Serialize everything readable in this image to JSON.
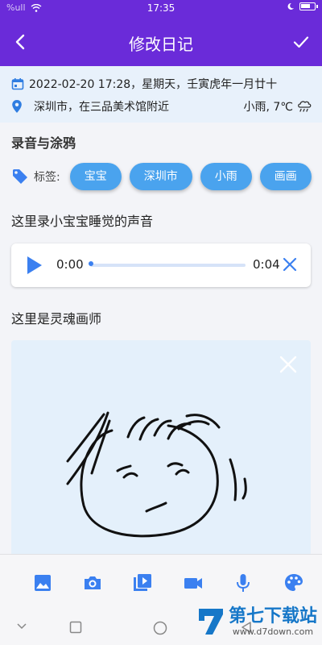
{
  "status_bar": {
    "signal_text": "%ull",
    "time": "17:35"
  },
  "app_bar": {
    "title": "修改日记",
    "back_icon": "arrow-back-icon",
    "confirm_icon": "check-icon"
  },
  "meta": {
    "datetime": "2022-02-20 17:28，星期天，壬寅虎年一月廿十",
    "location": "深圳市，在三品美术馆附近",
    "weather": "小雨, 7℃"
  },
  "section_title": "录音与涂鸦",
  "tags": {
    "label": "标签:",
    "items": [
      "宝宝",
      "深圳市",
      "小雨",
      "画画"
    ]
  },
  "audio_caption": "这里录小宝宝睡觉的声音",
  "audio": {
    "current": "0:00",
    "duration": "0:04",
    "progress": 0
  },
  "drawing_caption": "这里是灵魂画师",
  "toolbar": {
    "icons": [
      "image-icon",
      "camera-icon",
      "video-library-icon",
      "video-camera-icon",
      "mic-icon",
      "palette-icon"
    ]
  },
  "watermark": {
    "title": "第七下载站",
    "url": "www.d7down.com"
  },
  "colors": {
    "primary": "#6a2bd9",
    "accent": "#3b80f0",
    "chip": "#4aa3ee"
  }
}
